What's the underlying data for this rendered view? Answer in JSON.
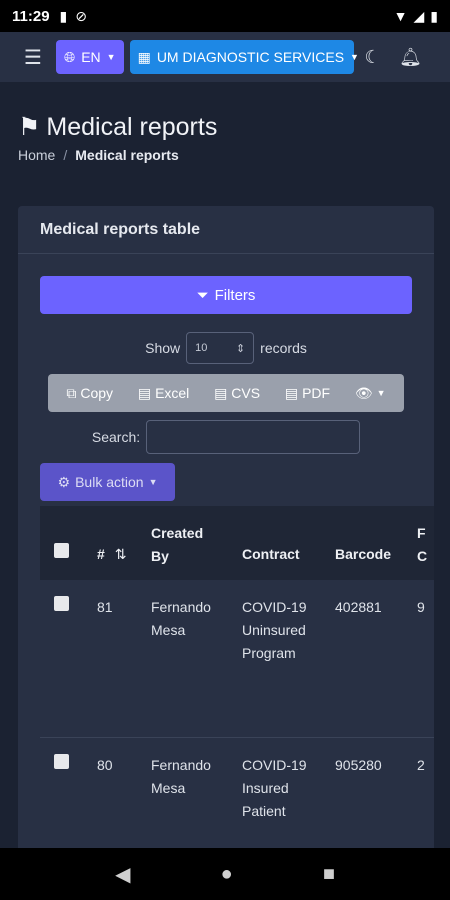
{
  "status_bar": {
    "time": "11:29"
  },
  "navbar": {
    "language": "EN",
    "branch": "UM DIAGNOSTIC SERVICES"
  },
  "page": {
    "title": "Medical reports",
    "breadcrumb": [
      "Home",
      "/",
      "Medical reports"
    ]
  },
  "card": {
    "title": "Medical reports table",
    "filters_label": "Filters",
    "show_label": "Show",
    "records_label": "records",
    "page_length": "10",
    "export_buttons": [
      "Copy",
      "Excel",
      "CVS",
      "PDF"
    ],
    "search_label": "Search:",
    "search_value": "",
    "bulk_action_label": "Bulk action"
  },
  "table": {
    "columns": [
      "#",
      "Created By",
      "Contract",
      "Barcode",
      "F"
    ],
    "column_created_by": [
      "Created",
      "By"
    ],
    "column_last_partial": [
      "F",
      "C"
    ],
    "rows": [
      {
        "id": "81",
        "created_by": [
          "Fernando",
          "Mesa"
        ],
        "contract": [
          "COVID-19",
          "Uninsured",
          "Program"
        ],
        "barcode": "402881",
        "partial": "9"
      },
      {
        "id": "80",
        "created_by": [
          "Fernando",
          "Mesa"
        ],
        "contract": [
          "COVID-19",
          "Insured",
          "Patient"
        ],
        "barcode": "905280",
        "partial": "2"
      }
    ]
  }
}
